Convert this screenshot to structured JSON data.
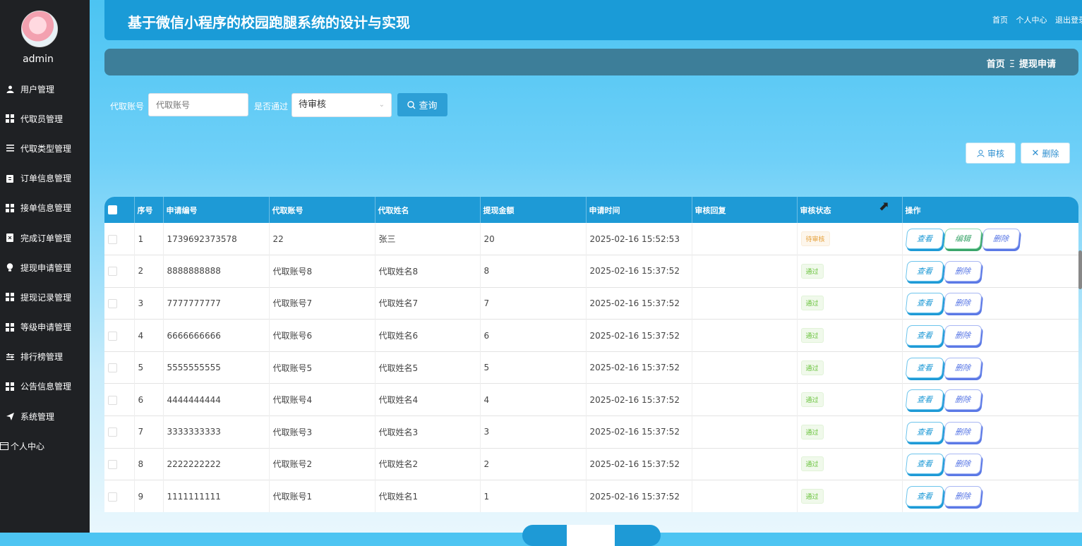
{
  "user": {
    "name": "admin"
  },
  "sidebar": {
    "items": [
      {
        "label": "用户管理",
        "icon": "user-icon"
      },
      {
        "label": "代取员管理",
        "icon": "grid-icon"
      },
      {
        "label": "代取类型管理",
        "icon": "list-icon"
      },
      {
        "label": "订单信息管理",
        "icon": "clipboard-icon"
      },
      {
        "label": "接单信息管理",
        "icon": "grid-icon"
      },
      {
        "label": "完成订单管理",
        "icon": "doc-x-icon"
      },
      {
        "label": "提现申请管理",
        "icon": "bulb-icon"
      },
      {
        "label": "提现记录管理",
        "icon": "grid-icon"
      },
      {
        "label": "等级申请管理",
        "icon": "grid-icon"
      },
      {
        "label": "排行榜管理",
        "icon": "sliders-icon"
      },
      {
        "label": "公告信息管理",
        "icon": "grid-icon"
      },
      {
        "label": "系统管理",
        "icon": "send-icon"
      },
      {
        "label": "个人中心",
        "icon": "card-icon"
      }
    ]
  },
  "header": {
    "title": "基于微信小程序的校园跑腿系统的设计与实现",
    "links": [
      "首页",
      "个人中心",
      "退出登录"
    ]
  },
  "breadcrumb": {
    "home": "首页",
    "separator": "Ξ",
    "current": "提现申请"
  },
  "search": {
    "account_label": "代取账号",
    "account_placeholder": "代取账号",
    "pass_label": "是否通过",
    "pass_value": "待审核",
    "query_button": "查询"
  },
  "actions": {
    "review": "审核",
    "delete": "删除"
  },
  "table": {
    "columns": [
      "序号",
      "申请编号",
      "代取账号",
      "代取姓名",
      "提现金额",
      "申请时间",
      "审核回复",
      "审核状态",
      "操作"
    ],
    "rows": [
      {
        "no": "1",
        "code": "1739692373578",
        "account": "22",
        "name": "张三",
        "amount": "20",
        "time": "2025-02-16 15:52:53",
        "reply": "",
        "status": "待审核",
        "ops": [
          "查看",
          "编辑",
          "删除"
        ]
      },
      {
        "no": "2",
        "code": "8888888888",
        "account": "代取账号8",
        "name": "代取姓名8",
        "amount": "8",
        "time": "2025-02-16 15:37:52",
        "reply": "",
        "status": "通过",
        "ops": [
          "查看",
          "删除"
        ]
      },
      {
        "no": "3",
        "code": "7777777777",
        "account": "代取账号7",
        "name": "代取姓名7",
        "amount": "7",
        "time": "2025-02-16 15:37:52",
        "reply": "",
        "status": "通过",
        "ops": [
          "查看",
          "删除"
        ]
      },
      {
        "no": "4",
        "code": "6666666666",
        "account": "代取账号6",
        "name": "代取姓名6",
        "amount": "6",
        "time": "2025-02-16 15:37:52",
        "reply": "",
        "status": "通过",
        "ops": [
          "查看",
          "删除"
        ]
      },
      {
        "no": "5",
        "code": "5555555555",
        "account": "代取账号5",
        "name": "代取姓名5",
        "amount": "5",
        "time": "2025-02-16 15:37:52",
        "reply": "",
        "status": "通过",
        "ops": [
          "查看",
          "删除"
        ]
      },
      {
        "no": "6",
        "code": "4444444444",
        "account": "代取账号4",
        "name": "代取姓名4",
        "amount": "4",
        "time": "2025-02-16 15:37:52",
        "reply": "",
        "status": "通过",
        "ops": [
          "查看",
          "删除"
        ]
      },
      {
        "no": "7",
        "code": "3333333333",
        "account": "代取账号3",
        "name": "代取姓名3",
        "amount": "3",
        "time": "2025-02-16 15:37:52",
        "reply": "",
        "status": "通过",
        "ops": [
          "查看",
          "删除"
        ]
      },
      {
        "no": "8",
        "code": "2222222222",
        "account": "代取账号2",
        "name": "代取姓名2",
        "amount": "2",
        "time": "2025-02-16 15:37:52",
        "reply": "",
        "status": "通过",
        "ops": [
          "查看",
          "删除"
        ]
      },
      {
        "no": "9",
        "code": "1111111111",
        "account": "代取账号1",
        "name": "代取姓名1",
        "amount": "1",
        "time": "2025-02-16 15:37:52",
        "reply": "",
        "status": "通过",
        "ops": [
          "查看",
          "删除"
        ]
      }
    ]
  },
  "colors": {
    "primary": "#1e9ad6",
    "sidebar_bg": "#1f2124",
    "crumb_bg": "#3d7e99",
    "pending": "#e6a23c",
    "pass": "#67c23a",
    "edit": "#3aa56a",
    "delete": "#5b79e6"
  }
}
